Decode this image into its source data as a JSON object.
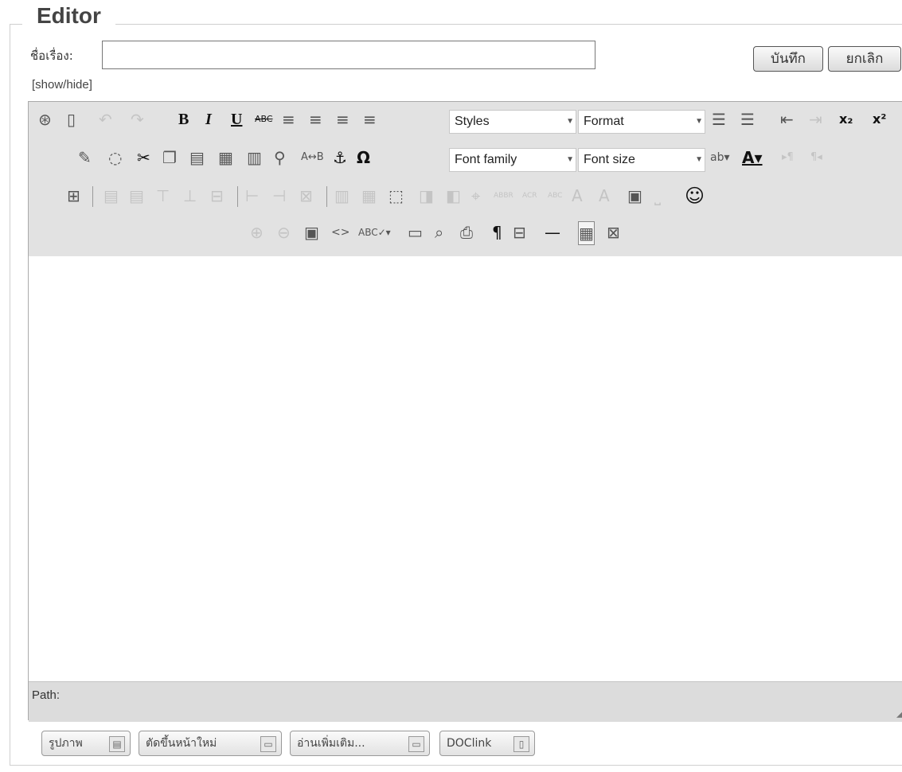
{
  "legend": "Editor",
  "title_label": "ชื่อเรื่อง:",
  "title_value": "",
  "save_label": "บันทึก",
  "cancel_label": "ยกเลิก",
  "showhide": "[show/hide]",
  "toolbar": {
    "styles": "Styles",
    "format": "Format",
    "font_family": "Font family",
    "font_size": "Font size",
    "bold": "B",
    "italic": "I",
    "underline": "U",
    "strike": "ABC",
    "subscript": "x₂",
    "superscript": "x²",
    "omega": "Ω",
    "pilcrow": "¶"
  },
  "status": {
    "path": "Path:"
  },
  "footer_buttons": [
    "รูปภาพ",
    "ตัดขึ้นหน้าใหม่",
    "อ่านเพิ่มเติม...",
    "DOClink"
  ]
}
